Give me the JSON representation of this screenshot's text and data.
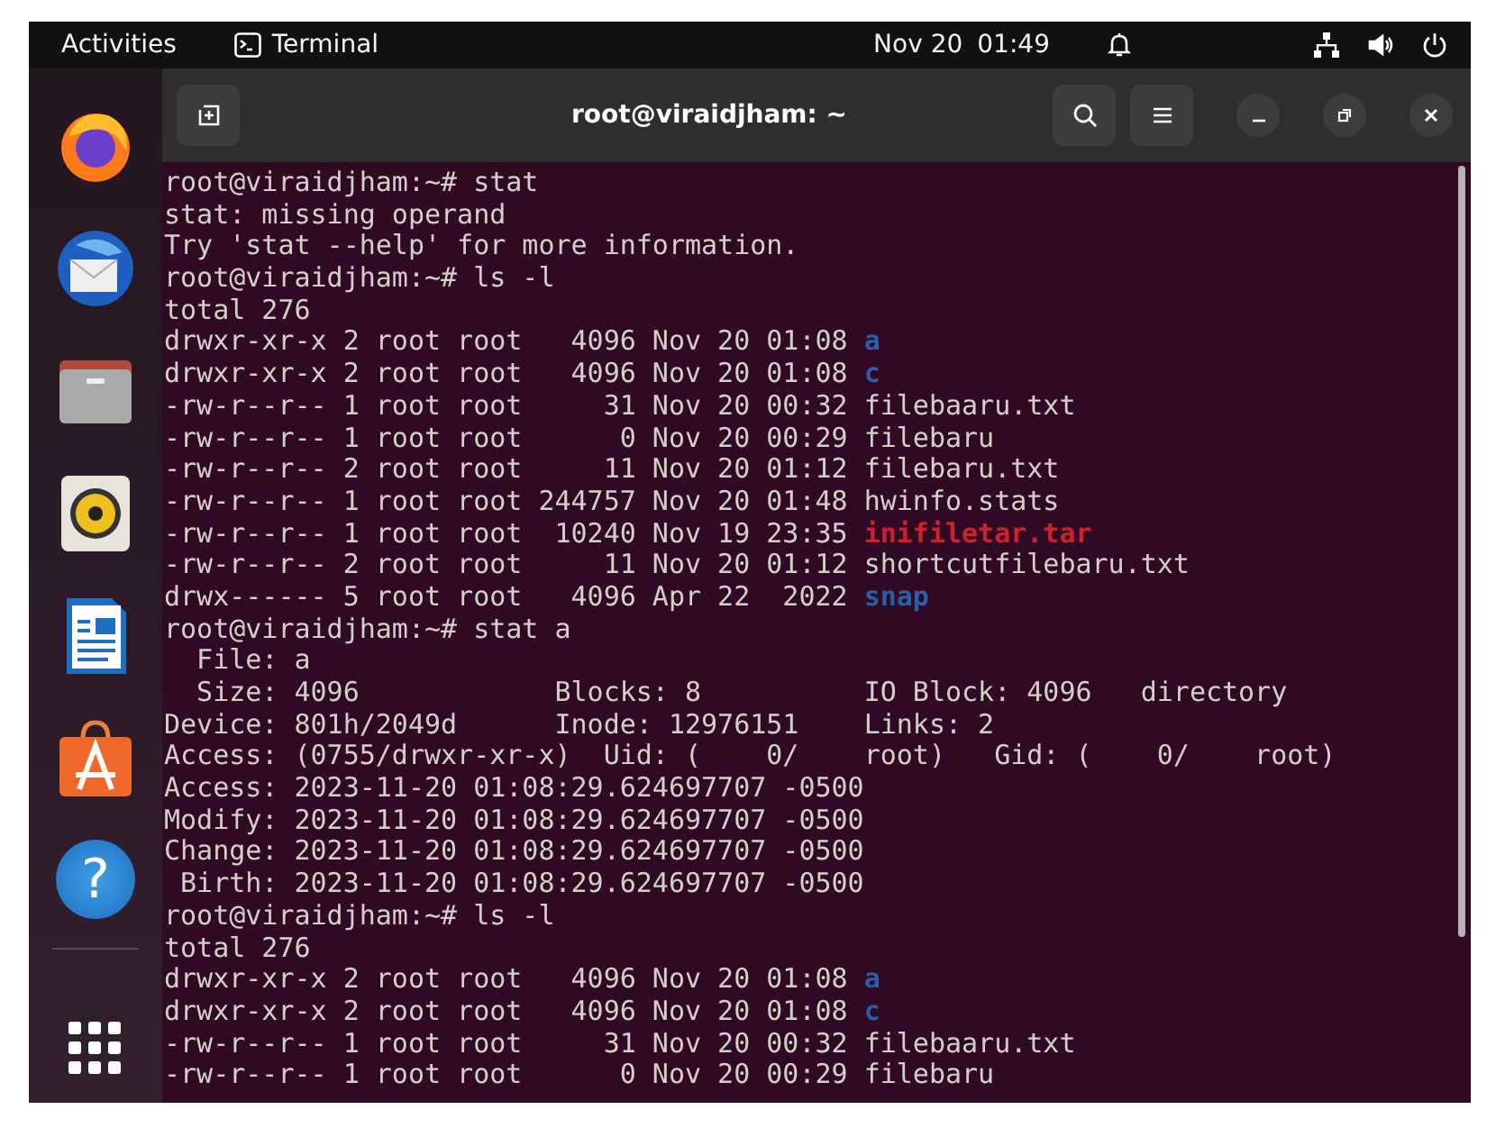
{
  "top_bar": {
    "activities": "Activities",
    "app": "Terminal",
    "date": "Nov 20",
    "time": "01:49"
  },
  "dock": [
    {
      "kind": "browser"
    },
    {
      "kind": "mail"
    },
    {
      "kind": "files"
    },
    {
      "kind": "music"
    },
    {
      "kind": "writer"
    },
    {
      "kind": "store"
    },
    {
      "kind": "help",
      "glyph": "?"
    },
    {
      "kind": "grid"
    }
  ],
  "terminal": {
    "title": "root@viraidjham: ~",
    "lines": [
      {
        "text": "root@viraidjham:~# stat"
      },
      {
        "text": "stat: missing operand"
      },
      {
        "text": "Try 'stat --help' for more information."
      },
      {
        "text": "root@viraidjham:~# ls -l"
      },
      {
        "text": "total 276"
      },
      {
        "text": "drwxr-xr-x 2 root root   4096 Nov 20 01:08 ",
        "file": {
          "name": "a",
          "kind": "dir"
        }
      },
      {
        "text": "drwxr-xr-x 2 root root   4096 Nov 20 01:08 ",
        "file": {
          "name": "c",
          "kind": "dir"
        }
      },
      {
        "text": "-rw-r--r-- 1 root root     31 Nov 20 00:32 ",
        "file": {
          "name": "filebaaru.txt",
          "kind": "file"
        }
      },
      {
        "text": "-rw-r--r-- 1 root root      0 Nov 20 00:29 ",
        "file": {
          "name": "filebaru",
          "kind": "file"
        }
      },
      {
        "text": "-rw-r--r-- 2 root root     11 Nov 20 01:12 ",
        "file": {
          "name": "filebaru.txt",
          "kind": "file"
        }
      },
      {
        "text": "-rw-r--r-- 1 root root 244757 Nov 20 01:48 ",
        "file": {
          "name": "hwinfo.stats",
          "kind": "file"
        }
      },
      {
        "text": "-rw-r--r-- 1 root root  10240 Nov 19 23:35 ",
        "file": {
          "name": "inifiletar.tar",
          "kind": "archive"
        }
      },
      {
        "text": "-rw-r--r-- 2 root root     11 Nov 20 01:12 ",
        "file": {
          "name": "shortcutfilebaru.txt",
          "kind": "file"
        }
      },
      {
        "text": "drwx------ 5 root root   4096 Apr 22  2022 ",
        "file": {
          "name": "snap",
          "kind": "dir"
        }
      },
      {
        "text": "root@viraidjham:~# stat a"
      },
      {
        "text": "  File: a"
      },
      {
        "text": "  Size: 4096            Blocks: 8          IO Block: 4096   directory"
      },
      {
        "text": "Device: 801h/2049d      Inode: 12976151    Links: 2"
      },
      {
        "text": "Access: (0755/drwxr-xr-x)  Uid: (    0/    root)   Gid: (    0/    root)"
      },
      {
        "text": "Access: 2023-11-20 01:08:29.624697707 -0500"
      },
      {
        "text": "Modify: 2023-11-20 01:08:29.624697707 -0500"
      },
      {
        "text": "Change: 2023-11-20 01:08:29.624697707 -0500"
      },
      {
        "text": " Birth: 2023-11-20 01:08:29.624697707 -0500"
      },
      {
        "text": "root@viraidjham:~# ls -l"
      },
      {
        "text": "total 276"
      },
      {
        "text": "drwxr-xr-x 2 root root   4096 Nov 20 01:08 ",
        "file": {
          "name": "a",
          "kind": "dir"
        }
      },
      {
        "text": "drwxr-xr-x 2 root root   4096 Nov 20 01:08 ",
        "file": {
          "name": "c",
          "kind": "dir"
        }
      },
      {
        "text": "-rw-r--r-- 1 root root     31 Nov 20 00:32 ",
        "file": {
          "name": "filebaaru.txt",
          "kind": "file"
        }
      },
      {
        "text": "-rw-r--r-- 1 root root      0 Nov 20 00:29 ",
        "file": {
          "name": "filebaru",
          "kind": "file"
        }
      }
    ]
  }
}
